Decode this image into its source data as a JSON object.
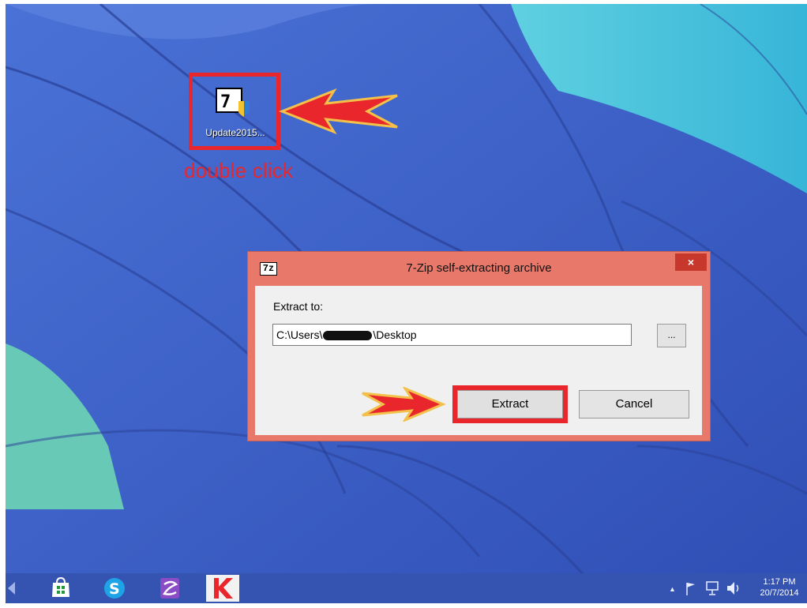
{
  "desktop": {
    "icon": {
      "name": "7zip-archive-icon",
      "label": "Update2015..."
    },
    "annotation": "double click"
  },
  "dialog": {
    "title": "7-Zip self-extracting archive",
    "title_icon_text": "7z",
    "close_label": "×",
    "extract_to_label": "Extract to:",
    "path_prefix": "C:\\Users\\",
    "path_suffix": "\\Desktop",
    "browse_label": "...",
    "extract_label": "Extract",
    "cancel_label": "Cancel"
  },
  "taskbar": {
    "clock_time": "1:17 PM",
    "clock_date": "20/7/2014",
    "tray_chevron": "▲"
  },
  "colors": {
    "annotation_red": "#e8262c",
    "taskbar": "#3553b0",
    "dialog_frame": "#e8786a"
  }
}
